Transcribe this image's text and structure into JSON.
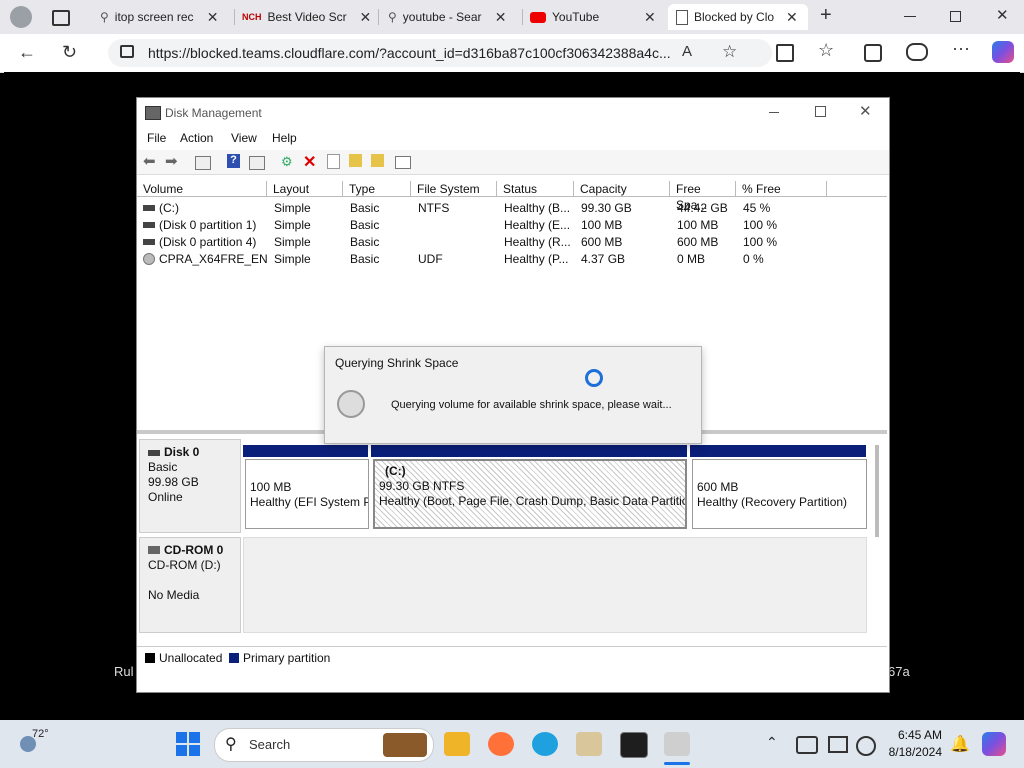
{
  "browser": {
    "tabs": [
      {
        "title": "itop screen rec"
      },
      {
        "title": "Best Video Scr"
      },
      {
        "title": "youtube - Sear"
      },
      {
        "title": "YouTube"
      },
      {
        "title": "Blocked by Clo"
      }
    ],
    "url": "https://blocked.teams.cloudflare.com/?account_id=d316ba87c100cf306342388a4c...",
    "new_tab_label": "+"
  },
  "remote_text": {
    "left": "Rul",
    "right": "67a"
  },
  "disk_management": {
    "title": "Disk Management",
    "menu": [
      "File",
      "Action",
      "View",
      "Help"
    ],
    "columns": [
      "Volume",
      "Layout",
      "Type",
      "File System",
      "Status",
      "Capacity",
      "Free Spa...",
      "% Free"
    ],
    "volumes": [
      {
        "volume": "(C:)",
        "layout": "Simple",
        "type": "Basic",
        "fs": "NTFS",
        "status": "Healthy (B...",
        "capacity": "99.30 GB",
        "free": "44.42 GB",
        "pct": "45 %"
      },
      {
        "volume": "(Disk 0 partition 1)",
        "layout": "Simple",
        "type": "Basic",
        "fs": "",
        "status": "Healthy (E...",
        "capacity": "100 MB",
        "free": "100 MB",
        "pct": "100 %"
      },
      {
        "volume": "(Disk 0 partition 4)",
        "layout": "Simple",
        "type": "Basic",
        "fs": "",
        "status": "Healthy (R...",
        "capacity": "600 MB",
        "free": "600 MB",
        "pct": "100 %"
      },
      {
        "volume": "CPRA_X64FRE_EN-...",
        "layout": "Simple",
        "type": "Basic",
        "fs": "UDF",
        "status": "Healthy (P...",
        "capacity": "4.37 GB",
        "free": "0 MB",
        "pct": "0 %"
      }
    ],
    "disk0": {
      "name": "Disk 0",
      "type": "Basic",
      "size": "99.98 GB",
      "state": "Online",
      "partitions": [
        {
          "line1": "100 MB",
          "line2": "Healthy (EFI System P"
        },
        {
          "line0": "(C:)",
          "line1": "99.30 GB NTFS",
          "line2": "Healthy (Boot, Page File, Crash Dump, Basic Data Partition"
        },
        {
          "line1": "600 MB",
          "line2": "Healthy (Recovery Partition)"
        }
      ]
    },
    "cdrom0": {
      "name": "CD-ROM 0",
      "drive": "CD-ROM (D:)",
      "media": "No Media"
    },
    "legend": [
      "Unallocated",
      "Primary partition"
    ]
  },
  "dialog": {
    "title": "Querying Shrink Space",
    "message": "Querying volume for available shrink space, please wait..."
  },
  "taskbar": {
    "weather": "72°",
    "search_placeholder": "Search",
    "time": "6:45 AM",
    "date": "8/18/2024"
  },
  "colors": {
    "primary_partition": "#0a1f7a",
    "unallocated": "#000000",
    "accent": "#1e6fd9"
  }
}
